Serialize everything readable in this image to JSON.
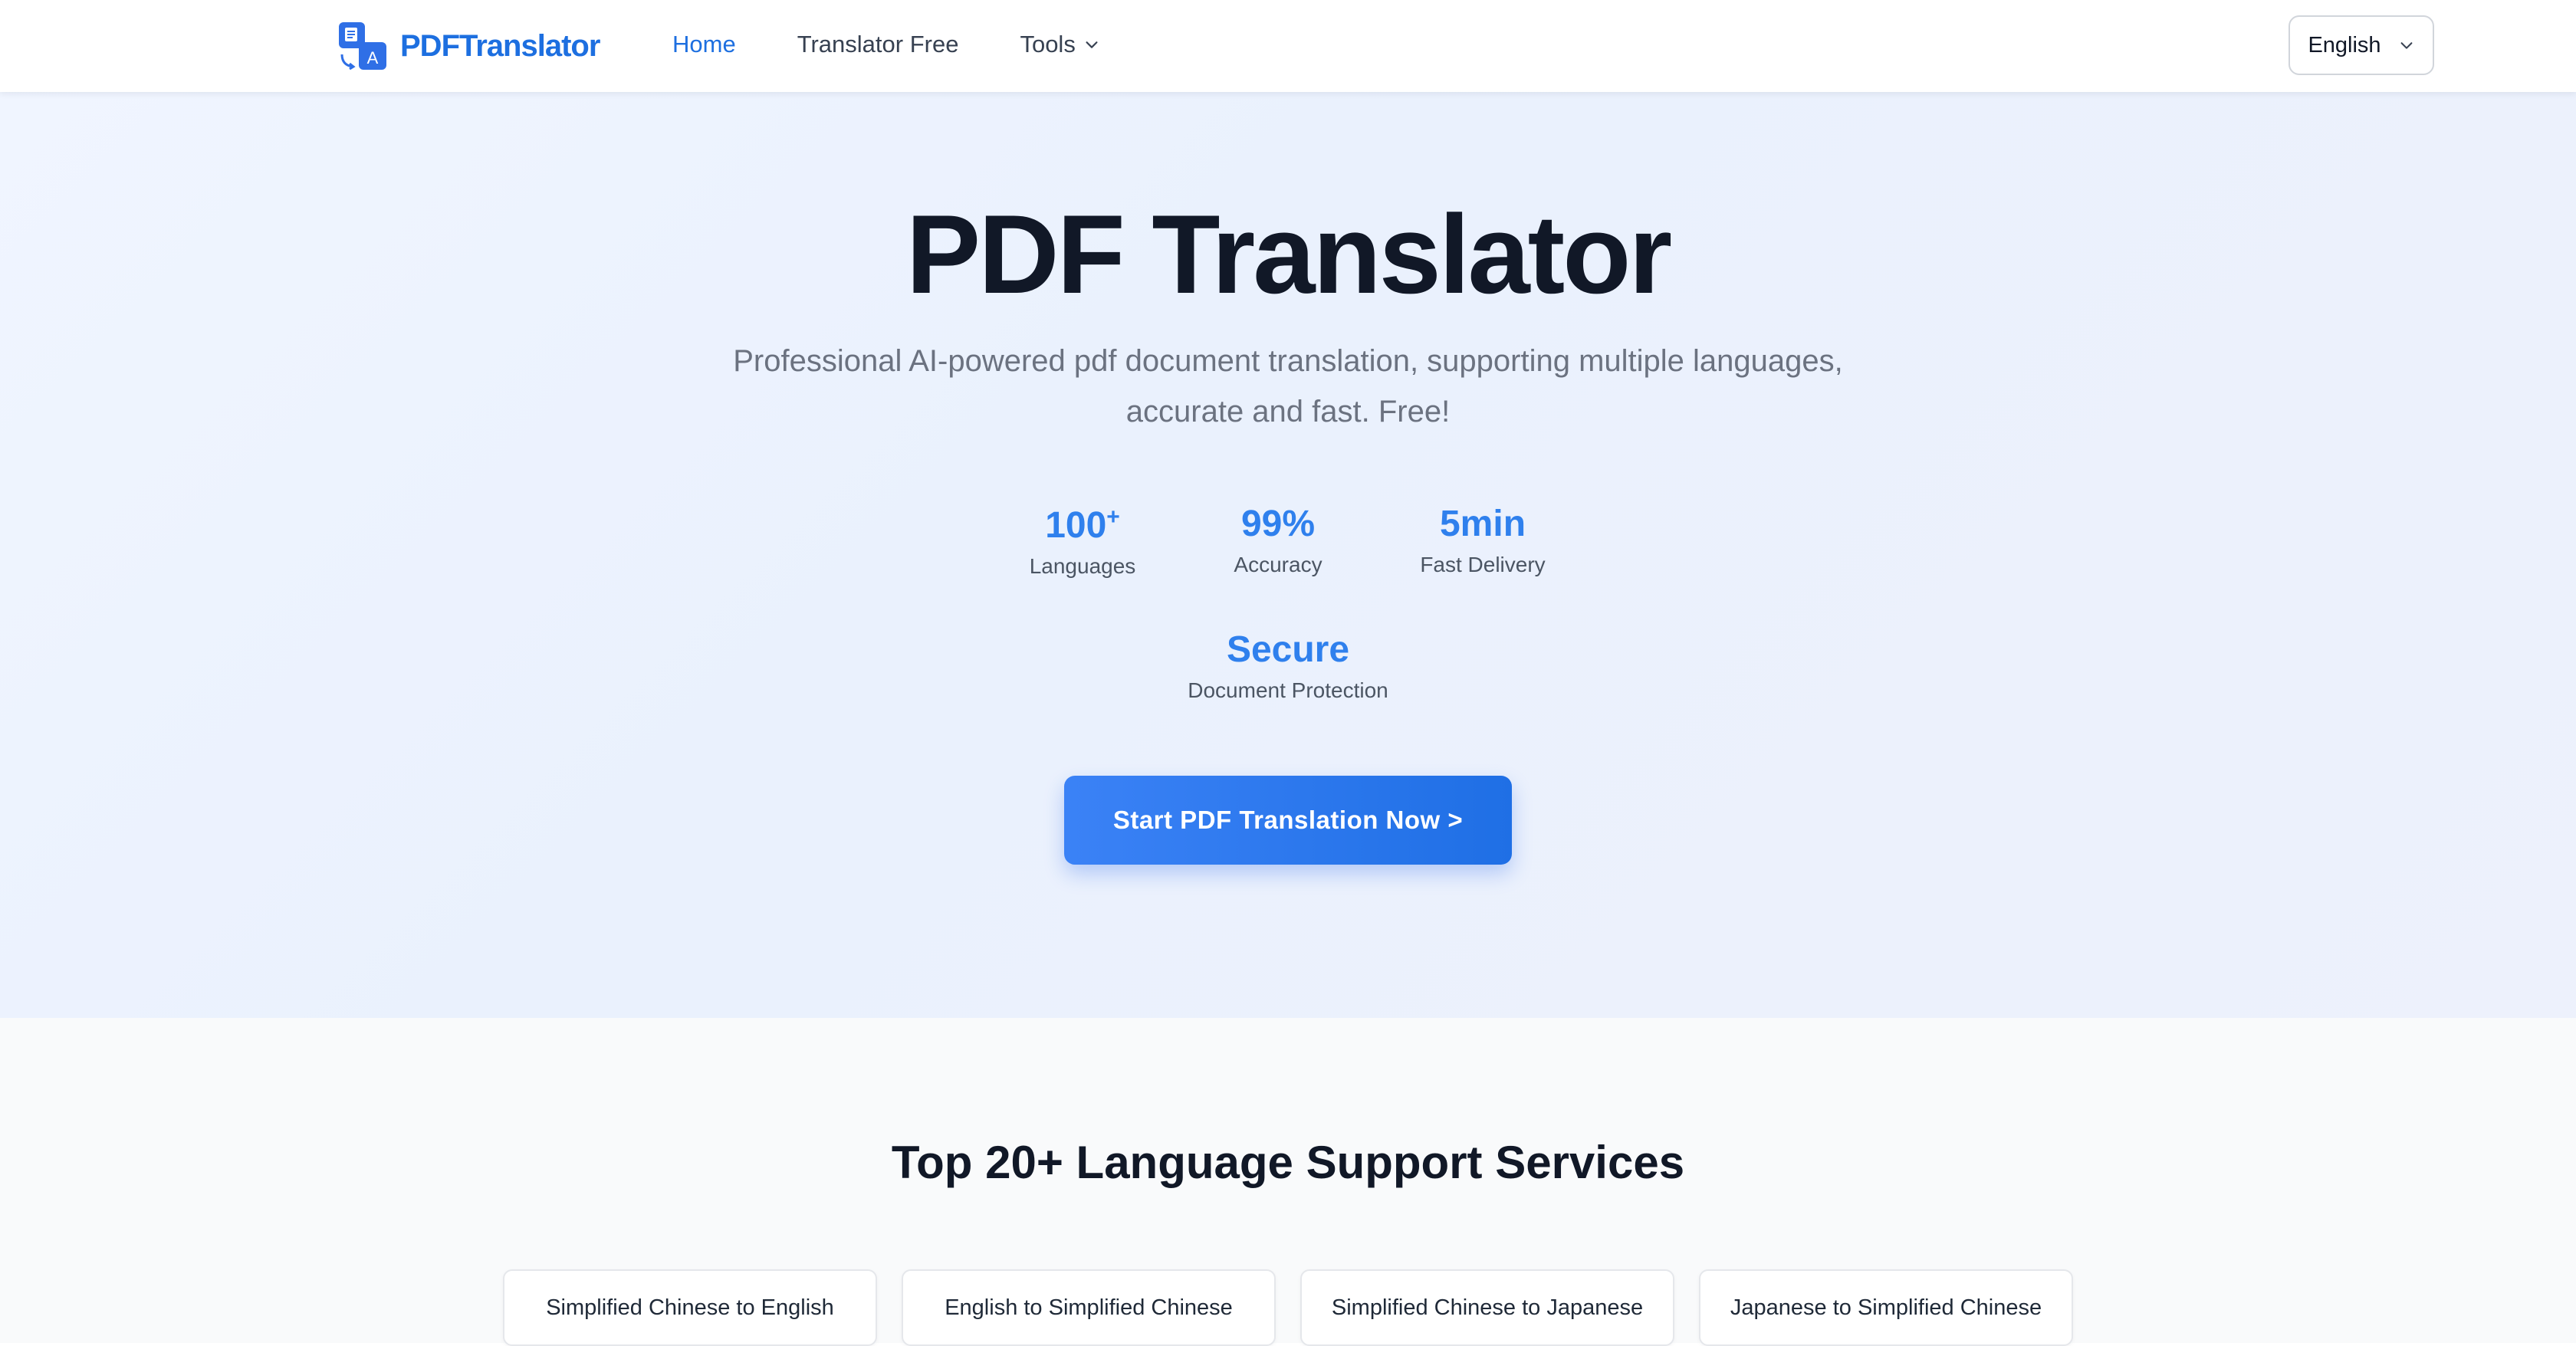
{
  "header": {
    "logo_text": "PDFTranslator",
    "nav": [
      {
        "label": "Home"
      },
      {
        "label": "Translator Free"
      },
      {
        "label": "Tools"
      }
    ],
    "language_selector": "English"
  },
  "hero": {
    "title": "PDF Translator",
    "subtitle_line1": "Professional AI-powered pdf document translation, supporting multiple languages,",
    "subtitle_line2": "accurate and fast. Free!",
    "stats": [
      {
        "value": "100",
        "suffix": "+",
        "label": "Languages"
      },
      {
        "value": "99%",
        "label": "Accuracy"
      },
      {
        "value": "5min",
        "label": "Fast Delivery"
      },
      {
        "value": "Secure",
        "label": "Document Protection"
      }
    ],
    "cta_label": "Start PDF Translation Now >"
  },
  "languages_section": {
    "title": "Top 20+ Language Support Services",
    "pairs": [
      "Simplified Chinese to English",
      "English to Simplified Chinese",
      "Simplified Chinese to Japanese",
      "Japanese to Simplified Chinese"
    ]
  },
  "colors": {
    "brand": "#1d6fe0",
    "accent": "#2f80ed",
    "cta_start": "#3b82f6",
    "cta_end": "#1f6fe5"
  }
}
